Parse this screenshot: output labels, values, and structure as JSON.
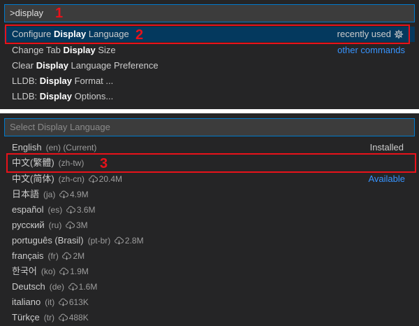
{
  "command_palette": {
    "input_value": ">display",
    "items": [
      {
        "pre": "Configure ",
        "match": "Display",
        "post": " Language",
        "right": "recently used",
        "icon": "gear-icon"
      },
      {
        "pre": "Change Tab ",
        "match": "Display",
        "post": " Size",
        "right": "other commands"
      },
      {
        "pre": "Clear ",
        "match": "Display",
        "post": " Language Preference"
      },
      {
        "pre": "LLDB: ",
        "match": "Display",
        "post": " Format ..."
      },
      {
        "pre": "LLDB: ",
        "match": "Display",
        "post": " Options..."
      }
    ]
  },
  "language_picker": {
    "placeholder": "Select Display Language",
    "items": [
      {
        "name": "English",
        "code": "(en) (Current)",
        "right": "Installed"
      },
      {
        "name": "中文(繁體)",
        "code": "(zh-tw)"
      },
      {
        "name": "中文(简体)",
        "code": "(zh-cn)",
        "downloads": "20.4M",
        "right": "Available"
      },
      {
        "name": "日本語",
        "code": "(ja)",
        "downloads": "4.9M"
      },
      {
        "name": "español",
        "code": "(es)",
        "downloads": "3.6M"
      },
      {
        "name": "русский",
        "code": "(ru)",
        "downloads": "3M"
      },
      {
        "name": "português (Brasil)",
        "code": "(pt-br)",
        "downloads": "2.8M"
      },
      {
        "name": "français",
        "code": "(fr)",
        "downloads": "2M"
      },
      {
        "name": "한국어",
        "code": "(ko)",
        "downloads": "1.9M"
      },
      {
        "name": "Deutsch",
        "code": "(de)",
        "downloads": "1.6M"
      },
      {
        "name": "italiano",
        "code": "(it)",
        "downloads": "613K"
      },
      {
        "name": "Türkçe",
        "code": "(tr)",
        "downloads": "488K"
      }
    ]
  },
  "annotations": [
    "1",
    "2",
    "3"
  ],
  "colors": {
    "accent": "#007acc",
    "highlight": "#e8121a",
    "link": "#3794ff",
    "background": "#252526"
  }
}
